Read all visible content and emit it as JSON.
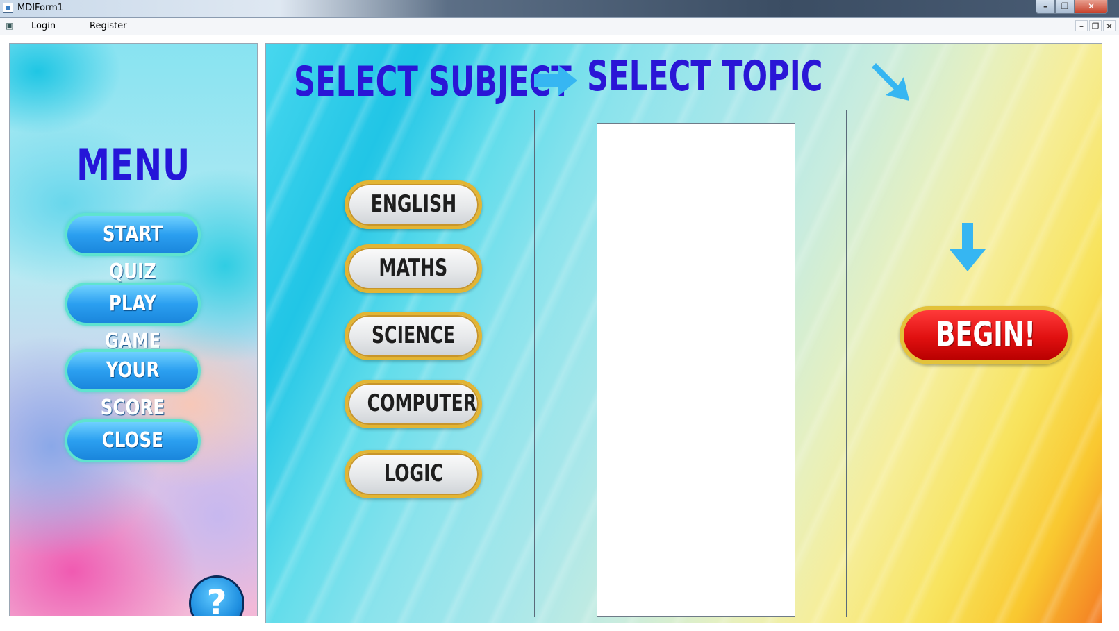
{
  "window": {
    "title": "MDIForm1"
  },
  "menubar": {
    "items": [
      "Login",
      "Register"
    ]
  },
  "sidebar": {
    "title": "MENU",
    "buttons": [
      "START QUIZ",
      "PLAY GAME",
      "YOUR SCORE",
      "CLOSE"
    ],
    "help_label": "?"
  },
  "main": {
    "subject_heading": "SELECT SUBJECT",
    "topic_heading": "SELECT TOPIC",
    "subjects": [
      "ENGLISH",
      "MATHS",
      "SCIENCE",
      "COMPUTER",
      "LOGIC"
    ],
    "begin_label": "BEGIN!"
  },
  "colors": {
    "heading": "#2a16d6",
    "menu_button": "#2b9ff0",
    "subject_button_border": "#e2b533",
    "begin_button": "#e01010",
    "arrow": "#36b6f2"
  },
  "icons": {
    "arrow_right": "arrow-right-icon",
    "arrow_down_right": "arrow-down-right-icon",
    "arrow_down": "arrow-down-icon",
    "help": "question-icon"
  }
}
